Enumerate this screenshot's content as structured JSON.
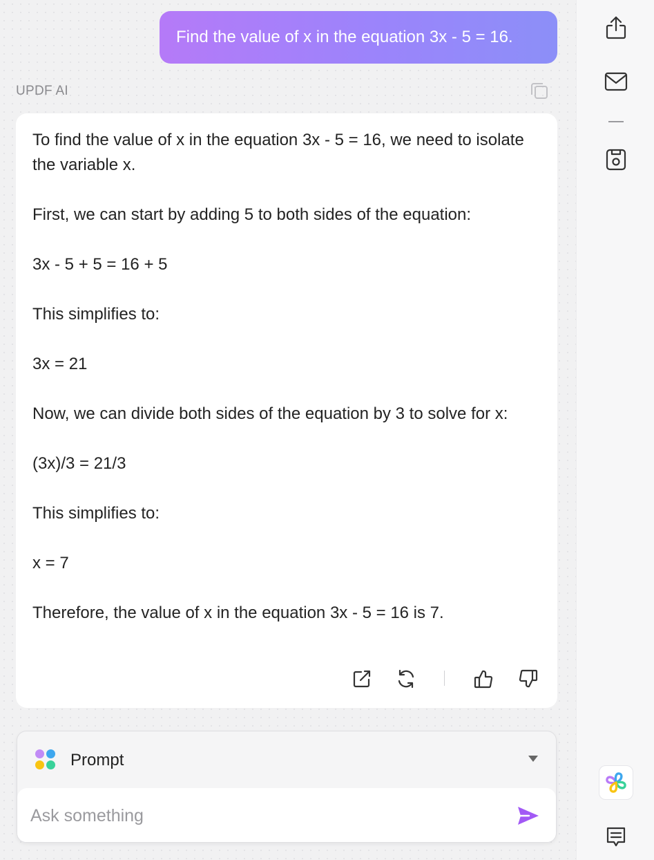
{
  "conversation": {
    "user_message": "Find the value of x in the equation 3x - 5 = 16.",
    "assistant_name": "UPDF AI",
    "answer_paragraphs": [
      "To find the value of x in the equation 3x - 5 = 16, we need to isolate the variable x.",
      "First, we can start by adding 5 to both sides of the equation:",
      "3x - 5 + 5 = 16 + 5",
      "This simplifies to:",
      "3x = 21",
      "Now, we can divide both sides of the equation by 3 to solve for x:",
      "(3x)/3 = 21/3",
      "This simplifies to:",
      "x = 7",
      "Therefore, the value of x in the equation 3x - 5 = 16 is 7."
    ]
  },
  "answer_actions": [
    "open-external-icon",
    "regenerate-icon",
    "thumbs-up-icon",
    "thumbs-down-icon"
  ],
  "input": {
    "prompt_label": "Prompt",
    "placeholder": "Ask something"
  },
  "right_rail": [
    "share-icon",
    "email-icon",
    "minimize-icon",
    "save-icon",
    "updf-ai-logo-icon",
    "comment-icon"
  ],
  "colors": {
    "user_bubble_start": "#b57af8",
    "user_bubble_end": "#8c8ff8",
    "send": "#a259f5",
    "prompt_dot_purple": "#c18bf6",
    "prompt_dot_blue": "#3ea7ee",
    "prompt_dot_yellow": "#f9c412",
    "prompt_dot_green": "#39d29a"
  }
}
